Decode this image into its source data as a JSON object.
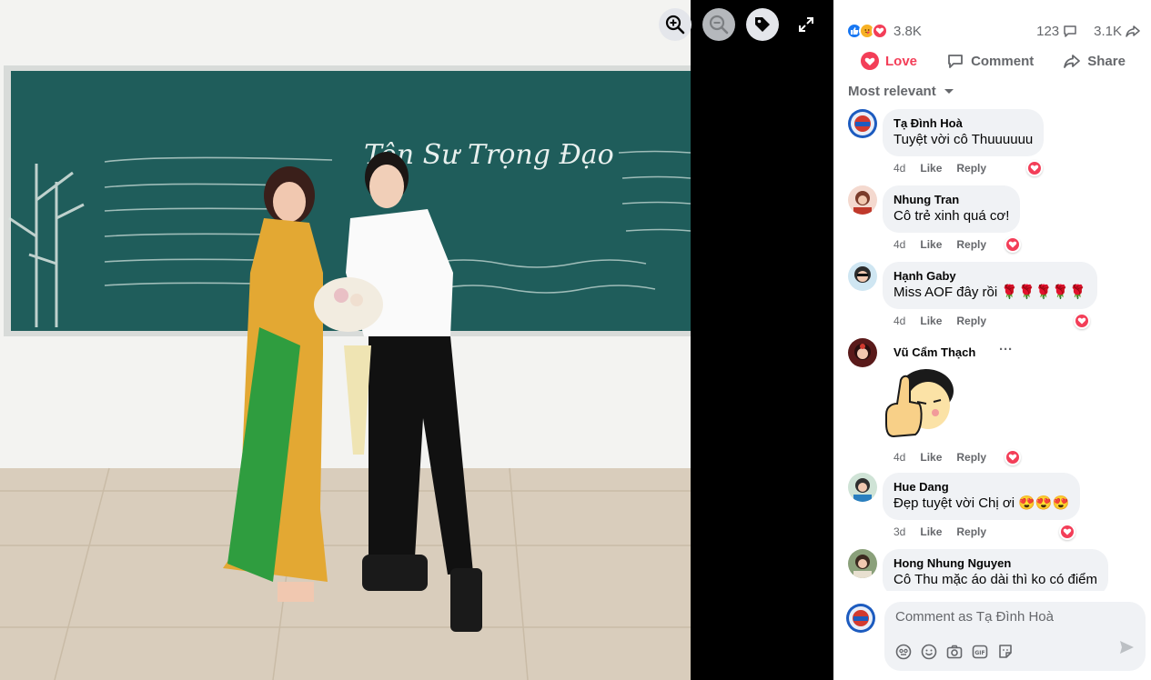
{
  "viewer": {
    "icons": [
      "zoom-in-icon",
      "zoom-out-icon",
      "tag-icon",
      "fullscreen-icon"
    ]
  },
  "post": {
    "reaction_count": "3.8K",
    "comment_count": "123",
    "share_count": "3.1K",
    "actions": {
      "love": "Love",
      "comment": "Comment",
      "share": "Share"
    },
    "sort_label": "Most relevant"
  },
  "comments": [
    {
      "name": "Tạ Đình Hoà",
      "text": "Tuyệt vời cô Thuuuuuu",
      "time": "4d",
      "like": "Like",
      "reply": "Reply",
      "reaction": "love"
    },
    {
      "name": "Nhung Tran",
      "text": "Cô trẻ xinh quá cơ!",
      "time": "4d",
      "like": "Like",
      "reply": "Reply",
      "reaction": "love"
    },
    {
      "name": "Hạnh Gaby",
      "text": "Miss AOF đây rồi 🌹🌹🌹🌹🌹",
      "time": "4d",
      "like": "Like",
      "reply": "Reply",
      "reaction": "love"
    },
    {
      "name": "Vũ Cẩm Thạch",
      "text": "",
      "time": "4d",
      "like": "Like",
      "reply": "Reply",
      "reaction": "love",
      "sticker": "thumbs-up-sticker",
      "more": "···"
    },
    {
      "name": "Hue Dang",
      "text": "Đẹp tuyệt vời Chị ơi 😍😍😍",
      "time": "3d",
      "like": "Like",
      "reply": "Reply",
      "reaction": "love"
    },
    {
      "name": "Hong Nhung Nguyen",
      "text": "Cô Thu mặc áo dài thì ko có điểm",
      "time": "",
      "like": "",
      "reply": "",
      "reaction": ""
    }
  ],
  "composer": {
    "placeholder": "Comment as Tạ Đình Hoà",
    "tools": [
      "avatar-sticker-icon",
      "emoji-icon",
      "camera-icon",
      "gif-icon",
      "sticker-icon"
    ]
  },
  "photo": {
    "chalkboard_title": "Tôn Sư Trọng Đạo"
  },
  "colors": {
    "love": "#f33e58",
    "like": "#1877f2",
    "bubble": "#f0f2f5",
    "muted": "#65676b"
  }
}
